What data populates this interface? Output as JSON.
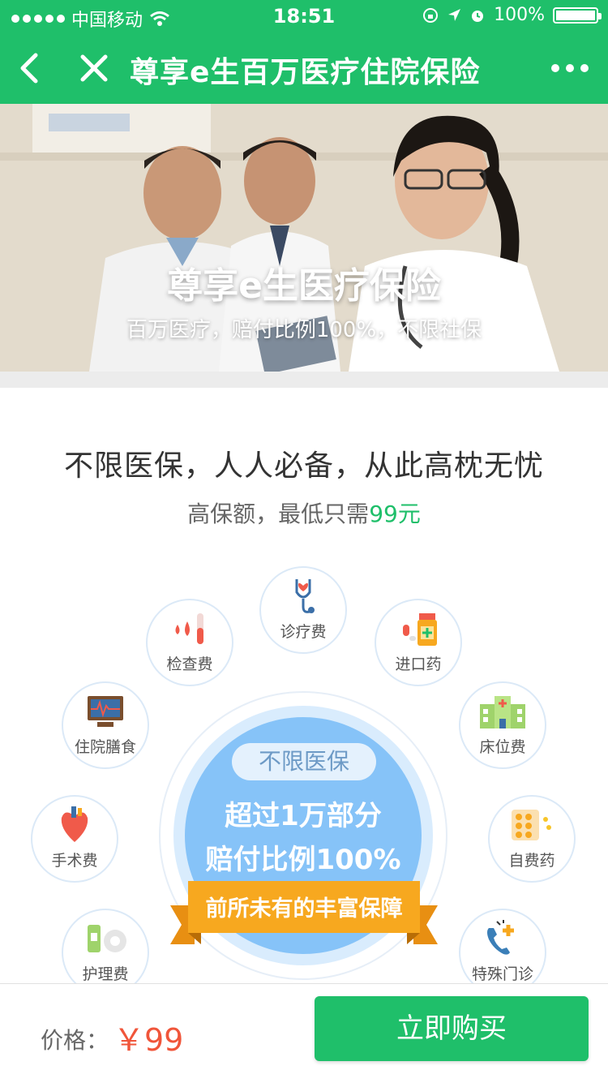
{
  "status_bar": {
    "carrier": "中国移动",
    "time": "18:51",
    "battery": "100%"
  },
  "nav": {
    "title": "尊享e生百万医疗住院保险",
    "back_icon": "chevron-left-icon",
    "close_icon": "close-icon",
    "more_icon": "more-dots-icon"
  },
  "banner": {
    "title": "尊享e生医疗保险",
    "subtitle": "百万医疗，赔付比例100%，不限社保"
  },
  "intro": {
    "slogan": "不限医保，人人必备，从此高枕无忧",
    "sub_prefix": "高保额，最低只需",
    "sub_price": "99元"
  },
  "coverage": {
    "items": [
      {
        "label": "诊疗费",
        "icon": "stethoscope-icon"
      },
      {
        "label": "检查费",
        "icon": "blood-test-icon"
      },
      {
        "label": "进口药",
        "icon": "medicine-bottle-icon"
      },
      {
        "label": "住院膳食",
        "icon": "monitor-icon"
      },
      {
        "label": "床位费",
        "icon": "hospital-icon"
      },
      {
        "label": "手术费",
        "icon": "heart-icon"
      },
      {
        "label": "自费药",
        "icon": "pills-icon"
      },
      {
        "label": "护理费",
        "icon": "bandage-icon"
      },
      {
        "label": "特殊门诊",
        "icon": "phone-247-icon"
      }
    ],
    "center_pill": "不限医保",
    "center_line1": "超过1万部分",
    "center_line2": "赔付比例100%",
    "ribbon": "前所未有的丰富保障"
  },
  "footer": {
    "price_label": "价格：",
    "price_value": "￥99",
    "buy_label": "立即购买"
  },
  "colors": {
    "brand_green": "#1fbf6a",
    "price_red": "#f0553a",
    "center_blue": "#86c3f8",
    "ribbon_orange": "#f7a81f"
  }
}
